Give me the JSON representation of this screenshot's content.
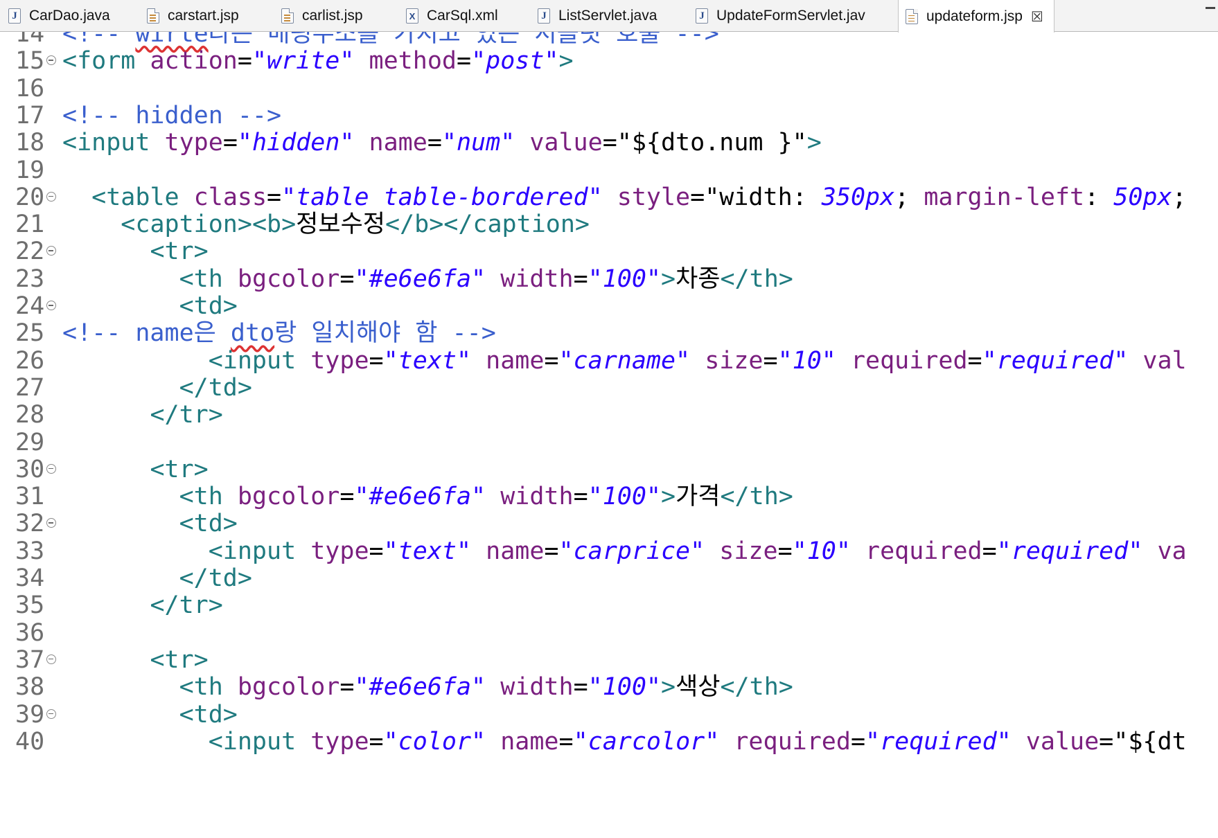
{
  "tabs": [
    {
      "label": "CarDao.java",
      "icon": "java-file-icon",
      "kind": "java",
      "active": false
    },
    {
      "label": "carstart.jsp",
      "icon": "jsp-file-icon",
      "kind": "jsp",
      "active": false
    },
    {
      "label": "carlist.jsp",
      "icon": "jsp-file-icon",
      "kind": "jsp",
      "active": false
    },
    {
      "label": "CarSql.xml",
      "icon": "xml-file-icon",
      "kind": "xml",
      "active": false
    },
    {
      "label": "ListServlet.java",
      "icon": "java-file-icon",
      "kind": "java",
      "active": false
    },
    {
      "label": "UpdateFormServlet.jav",
      "icon": "java-file-icon",
      "kind": "java",
      "active": false
    },
    {
      "label": "updateform.jsp",
      "icon": "jsp-file-icon",
      "kind": "jsp",
      "active": true
    }
  ],
  "colors": {
    "tag": "#1f7a7f",
    "attribute": "#7a1f7f",
    "string": "#2a00ff",
    "comment": "#3a5fcd",
    "line_number": "#6e6e6e"
  },
  "lines": [
    {
      "n": "14",
      "fold": false,
      "parts": [
        [
          "cm",
          "<!-- "
        ],
        [
          "cm sq",
          "wirte"
        ],
        [
          "cm",
          "라는 매핑주소를 가지고 있는 서블릿 호출 -->"
        ]
      ]
    },
    {
      "n": "15",
      "fold": true,
      "parts": [
        [
          "tag",
          "<form "
        ],
        [
          "attr",
          "action"
        ],
        [
          "",
          "="
        ],
        [
          "str",
          "\"write\""
        ],
        [
          "attr",
          " method"
        ],
        [
          "",
          "="
        ],
        [
          "str",
          "\"post\""
        ],
        [
          "tag",
          ">"
        ]
      ]
    },
    {
      "n": "16",
      "fold": false,
      "parts": []
    },
    {
      "n": "17",
      "fold": false,
      "parts": [
        [
          "cm",
          "<!-- hidden -->"
        ]
      ]
    },
    {
      "n": "18",
      "fold": false,
      "parts": [
        [
          "tag",
          "<input "
        ],
        [
          "attr",
          "type"
        ],
        [
          "",
          "="
        ],
        [
          "str",
          "\"hidden\""
        ],
        [
          "attr",
          " name"
        ],
        [
          "",
          "="
        ],
        [
          "str",
          "\"num\""
        ],
        [
          "attr",
          " value"
        ],
        [
          "",
          "=\"${dto.num }\""
        ],
        [
          "tag",
          ">"
        ]
      ]
    },
    {
      "n": "19",
      "fold": false,
      "parts": []
    },
    {
      "n": "20",
      "fold": true,
      "parts": [
        [
          "",
          "  "
        ],
        [
          "tag",
          "<table "
        ],
        [
          "attr",
          "class"
        ],
        [
          "",
          "="
        ],
        [
          "str",
          "\"table table-bordered\""
        ],
        [
          "attr",
          " style"
        ],
        [
          "",
          "=\"width: "
        ],
        [
          "str",
          "350px"
        ],
        [
          "",
          "; "
        ],
        [
          "attr",
          "margin-left"
        ],
        [
          "",
          ": "
        ],
        [
          "str",
          "50px"
        ],
        [
          "",
          ";"
        ]
      ]
    },
    {
      "n": "21",
      "fold": false,
      "parts": [
        [
          "",
          "    "
        ],
        [
          "tag",
          "<caption><b>"
        ],
        [
          "txt",
          "정보수정"
        ],
        [
          "tag",
          "</b></caption>"
        ]
      ]
    },
    {
      "n": "22",
      "fold": true,
      "parts": [
        [
          "",
          "      "
        ],
        [
          "tag",
          "<tr>"
        ]
      ]
    },
    {
      "n": "23",
      "fold": false,
      "parts": [
        [
          "",
          "        "
        ],
        [
          "tag",
          "<th "
        ],
        [
          "attr",
          "bgcolor"
        ],
        [
          "",
          "="
        ],
        [
          "str",
          "\"#e6e6fa\""
        ],
        [
          "attr",
          " width"
        ],
        [
          "",
          "="
        ],
        [
          "str",
          "\"100\""
        ],
        [
          "tag",
          ">"
        ],
        [
          "txt",
          "차종"
        ],
        [
          "tag",
          "</th>"
        ]
      ]
    },
    {
      "n": "24",
      "fold": true,
      "parts": [
        [
          "",
          "        "
        ],
        [
          "tag",
          "<td>"
        ]
      ]
    },
    {
      "n": "25",
      "fold": false,
      "parts": [
        [
          "cm",
          "<!-- name은 "
        ],
        [
          "cm sq",
          "dto"
        ],
        [
          "cm",
          "랑 일치해야 함 -->"
        ]
      ]
    },
    {
      "n": "26",
      "fold": false,
      "parts": [
        [
          "",
          "          "
        ],
        [
          "tag",
          "<input "
        ],
        [
          "attr",
          "type"
        ],
        [
          "",
          "="
        ],
        [
          "str",
          "\"text\""
        ],
        [
          "attr",
          " name"
        ],
        [
          "",
          "="
        ],
        [
          "str",
          "\"carname\""
        ],
        [
          "attr",
          " size"
        ],
        [
          "",
          "="
        ],
        [
          "str",
          "\"10\""
        ],
        [
          "attr",
          " required"
        ],
        [
          "",
          "="
        ],
        [
          "str",
          "\"required\""
        ],
        [
          "attr",
          " val"
        ]
      ]
    },
    {
      "n": "27",
      "fold": false,
      "parts": [
        [
          "",
          "        "
        ],
        [
          "tag",
          "</td>"
        ]
      ]
    },
    {
      "n": "28",
      "fold": false,
      "parts": [
        [
          "",
          "      "
        ],
        [
          "tag",
          "</tr>"
        ]
      ]
    },
    {
      "n": "29",
      "fold": false,
      "parts": []
    },
    {
      "n": "30",
      "fold": true,
      "parts": [
        [
          "",
          "      "
        ],
        [
          "tag",
          "<tr>"
        ]
      ]
    },
    {
      "n": "31",
      "fold": false,
      "parts": [
        [
          "",
          "        "
        ],
        [
          "tag",
          "<th "
        ],
        [
          "attr",
          "bgcolor"
        ],
        [
          "",
          "="
        ],
        [
          "str",
          "\"#e6e6fa\""
        ],
        [
          "attr",
          " width"
        ],
        [
          "",
          "="
        ],
        [
          "str",
          "\"100\""
        ],
        [
          "tag",
          ">"
        ],
        [
          "txt",
          "가격"
        ],
        [
          "tag",
          "</th>"
        ]
      ]
    },
    {
      "n": "32",
      "fold": true,
      "parts": [
        [
          "",
          "        "
        ],
        [
          "tag",
          "<td>"
        ]
      ]
    },
    {
      "n": "33",
      "fold": false,
      "parts": [
        [
          "",
          "          "
        ],
        [
          "tag",
          "<input "
        ],
        [
          "attr",
          "type"
        ],
        [
          "",
          "="
        ],
        [
          "str",
          "\"text\""
        ],
        [
          "attr",
          " name"
        ],
        [
          "",
          "="
        ],
        [
          "str",
          "\"carprice\""
        ],
        [
          "attr",
          " size"
        ],
        [
          "",
          "="
        ],
        [
          "str",
          "\"10\""
        ],
        [
          "attr",
          " required"
        ],
        [
          "",
          "="
        ],
        [
          "str",
          "\"required\""
        ],
        [
          "attr",
          " va"
        ]
      ]
    },
    {
      "n": "34",
      "fold": false,
      "parts": [
        [
          "",
          "        "
        ],
        [
          "tag",
          "</td>"
        ]
      ]
    },
    {
      "n": "35",
      "fold": false,
      "parts": [
        [
          "",
          "      "
        ],
        [
          "tag",
          "</tr>"
        ]
      ]
    },
    {
      "n": "36",
      "fold": false,
      "parts": []
    },
    {
      "n": "37",
      "fold": true,
      "parts": [
        [
          "",
          "      "
        ],
        [
          "tag",
          "<tr>"
        ]
      ]
    },
    {
      "n": "38",
      "fold": false,
      "parts": [
        [
          "",
          "        "
        ],
        [
          "tag",
          "<th "
        ],
        [
          "attr",
          "bgcolor"
        ],
        [
          "",
          "="
        ],
        [
          "str",
          "\"#e6e6fa\""
        ],
        [
          "attr",
          " width"
        ],
        [
          "",
          "="
        ],
        [
          "str",
          "\"100\""
        ],
        [
          "tag",
          ">"
        ],
        [
          "txt",
          "색상"
        ],
        [
          "tag",
          "</th>"
        ]
      ]
    },
    {
      "n": "39",
      "fold": true,
      "parts": [
        [
          "",
          "        "
        ],
        [
          "tag",
          "<td>"
        ]
      ]
    },
    {
      "n": "40",
      "fold": false,
      "parts": [
        [
          "",
          "          "
        ],
        [
          "tag",
          "<input "
        ],
        [
          "attr",
          "type"
        ],
        [
          "",
          "="
        ],
        [
          "str",
          "\"color\""
        ],
        [
          "attr",
          " name"
        ],
        [
          "",
          "="
        ],
        [
          "str",
          "\"carcolor\""
        ],
        [
          "attr",
          " required"
        ],
        [
          "",
          "="
        ],
        [
          "str",
          "\"required\""
        ],
        [
          "attr",
          " value"
        ],
        [
          "",
          "=\"${dt"
        ]
      ]
    }
  ]
}
